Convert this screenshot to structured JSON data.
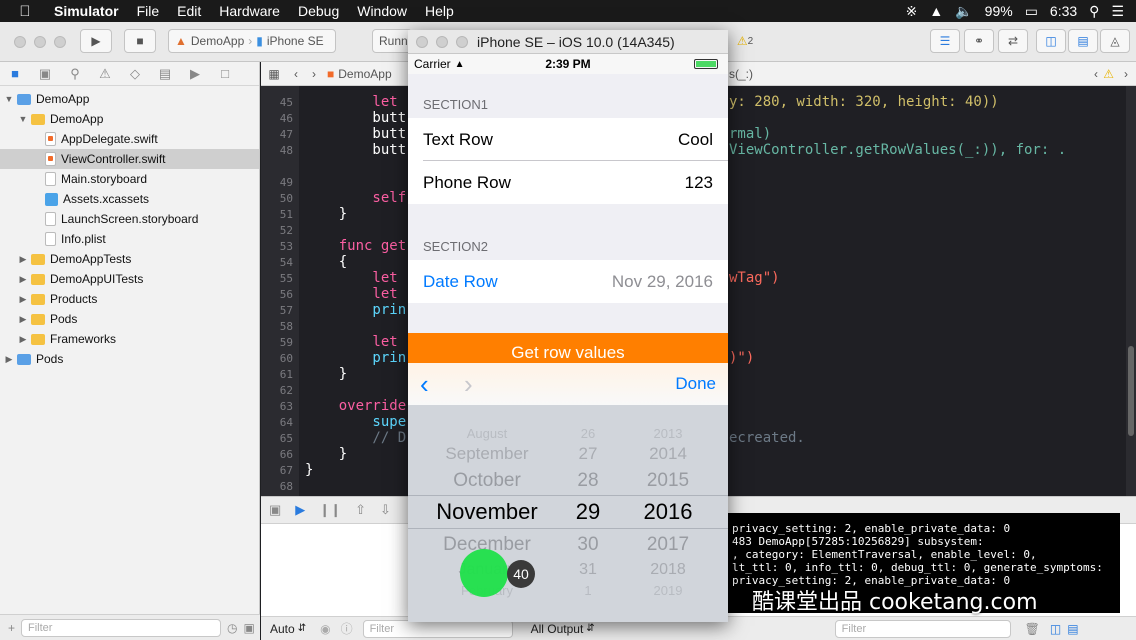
{
  "menubar": {
    "app": "Simulator",
    "items": [
      "File",
      "Edit",
      "Hardware",
      "Debug",
      "Window",
      "Help"
    ],
    "battery": "99%",
    "clock": "6:33"
  },
  "toolbar": {
    "scheme": "DemoApp",
    "device": "iPhone SE",
    "status": "Runni",
    "warning_count": "2"
  },
  "navigator": {
    "items": [
      {
        "label": "DemoApp",
        "kind": "project",
        "level": 0,
        "open": true
      },
      {
        "label": "DemoApp",
        "kind": "folder",
        "level": 1,
        "open": true
      },
      {
        "label": "AppDelegate.swift",
        "kind": "swift",
        "level": 2
      },
      {
        "label": "ViewController.swift",
        "kind": "swift",
        "level": 2,
        "selected": true
      },
      {
        "label": "Main.storyboard",
        "kind": "xib",
        "level": 2
      },
      {
        "label": "Assets.xcassets",
        "kind": "assets",
        "level": 2
      },
      {
        "label": "LaunchScreen.storyboard",
        "kind": "xib",
        "level": 2
      },
      {
        "label": "Info.plist",
        "kind": "plist",
        "level": 2
      },
      {
        "label": "DemoAppTests",
        "kind": "folder",
        "level": 1
      },
      {
        "label": "DemoAppUITests",
        "kind": "folder",
        "level": 1
      },
      {
        "label": "Products",
        "kind": "folder",
        "level": 1
      },
      {
        "label": "Pods",
        "kind": "folder",
        "level": 1
      },
      {
        "label": "Frameworks",
        "kind": "folder",
        "level": 1
      },
      {
        "label": "Pods",
        "kind": "project",
        "level": 0
      }
    ],
    "filter_placeholder": "Filter"
  },
  "jumpbar": {
    "crumb": "DemoApp",
    "right_fragment": "s(_:)"
  },
  "editor": {
    "line_numbers": [
      "45",
      "46",
      "47",
      "48",
      "",
      "49",
      "50",
      "51",
      "52",
      "53",
      "54",
      "55",
      "56",
      "57",
      "58",
      "59",
      "60",
      "61",
      "62",
      "63",
      "64",
      "65",
      "66",
      "67",
      "68"
    ],
    "right_code": [
      "y: 280, width: 320, height: 40))",
      "",
      "rmal)",
      "ViewController.getRowValues(_:)), for: .",
      "",
      "",
      "",
      "",
      "",
      "",
      "",
      "wTag\")",
      "",
      "",
      "",
      "",
      ")\")",
      "",
      "",
      "",
      "",
      "ecreated.",
      "",
      "",
      ""
    ],
    "left_code": [
      "        let",
      "        butt",
      "        butt",
      "        butt",
      "",
      "",
      "        self",
      "    }",
      "",
      "    func get",
      "    {",
      "        let",
      "        let",
      "        prin",
      "",
      "        let",
      "        prin",
      "    }",
      "",
      "    override",
      "        supe",
      "        // D",
      "    }",
      "}",
      ""
    ]
  },
  "debug": {
    "auto_label": "Auto",
    "output_label": "All Output",
    "filter_placeholder": "Filter",
    "console_lines": [
      "privacy_setting: 2, enable_private_data: 0",
      "483 DemoApp[57285:10256829] subsystem:",
      ", category: ElementTraversal, enable_level: 0,",
      "lt_ttl: 0, info_ttl: 0, debug_ttl: 0, generate_symptoms:",
      " privacy_setting: 2, enable_private_data: 0"
    ]
  },
  "watermark": "酷课堂出品 cooketang.com",
  "simulator": {
    "title": "iPhone SE – iOS 10.0 (14A345)",
    "carrier": "Carrier",
    "time": "2:39 PM",
    "section1": "SECTION1",
    "section2": "SECTION2",
    "rows": [
      {
        "label": "Text Row",
        "value": "Cool"
      },
      {
        "label": "Phone Row",
        "value": "123"
      }
    ],
    "date_row": {
      "label": "Date Row",
      "value": "Nov 29, 2016"
    },
    "button": "Get row values",
    "done": "Done",
    "picker": {
      "months": [
        "August",
        "September",
        "October",
        "November",
        "December",
        "January",
        "February"
      ],
      "days": [
        "26",
        "27",
        "28",
        "29",
        "30",
        "31",
        "1"
      ],
      "years": [
        "2013",
        "2014",
        "2015",
        "2016",
        "2017",
        "2018",
        "2019"
      ],
      "selected_index": 3
    },
    "touch_count": "40"
  },
  "colors": {
    "accent": "#007aff",
    "orange": "#ff7f00",
    "touch": "#1fe04a"
  }
}
